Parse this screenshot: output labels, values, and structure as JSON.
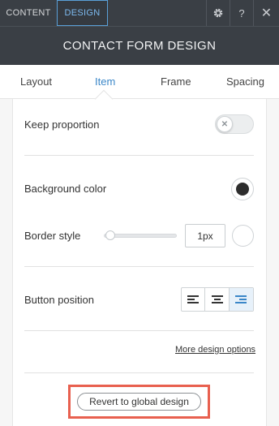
{
  "topbar": {
    "tabs": [
      {
        "label": "CONTENT",
        "active": false
      },
      {
        "label": "DESIGN",
        "active": true
      }
    ],
    "icons": [
      "gear-icon",
      "help-icon",
      "close-icon"
    ],
    "help_glyph": "?",
    "close_glyph": "✕"
  },
  "header": {
    "title": "CONTACT FORM DESIGN"
  },
  "subnav": {
    "items": [
      {
        "label": "Layout",
        "active": false
      },
      {
        "label": "Item",
        "active": true
      },
      {
        "label": "Frame",
        "active": false
      },
      {
        "label": "Spacing",
        "active": false
      }
    ]
  },
  "settings": {
    "keep_proportion": {
      "label": "Keep proportion",
      "enabled": false,
      "knob_glyph": "✕"
    },
    "background_color": {
      "label": "Background color",
      "value": "#2d2d2d"
    },
    "border_style": {
      "label": "Border style",
      "width": "1px",
      "slider_fraction": 0.0,
      "color": "#ffffff"
    },
    "button_position": {
      "label": "Button position",
      "options": [
        "left",
        "center",
        "right"
      ],
      "selected": "right"
    },
    "more_link": "More design options",
    "revert_button": "Revert to global design"
  },
  "colors": {
    "accent": "#3a86c8",
    "dark_header": "#3a3f45",
    "highlight": "#e8604f"
  }
}
